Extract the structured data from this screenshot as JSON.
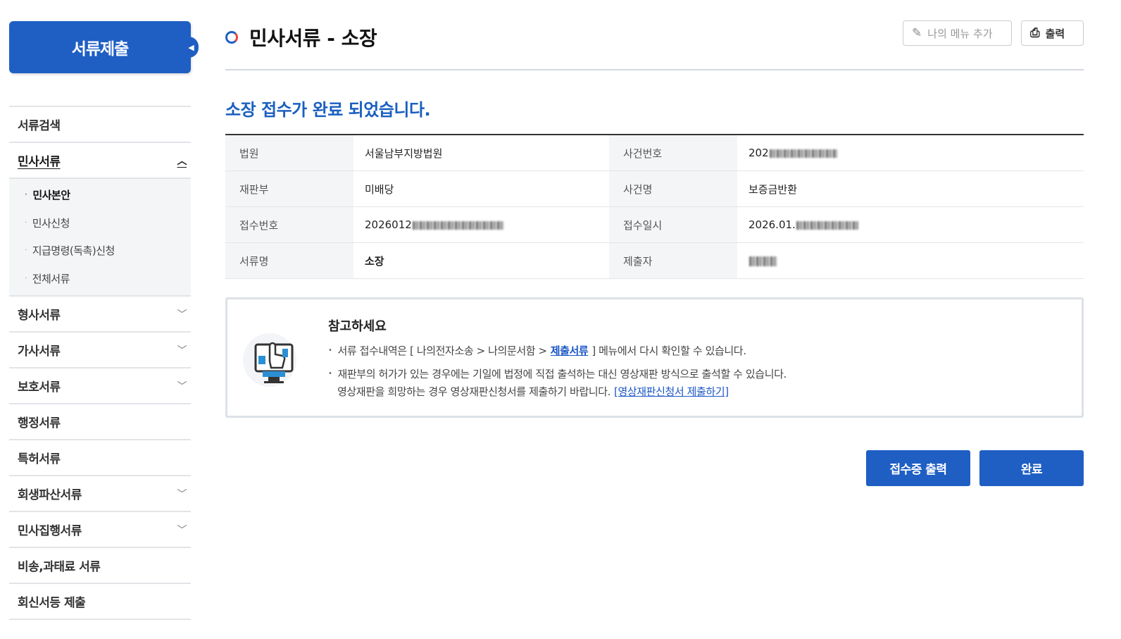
{
  "sidebar": {
    "title": "서류제출",
    "items": [
      {
        "label": "서류검색"
      },
      {
        "label": "민사서류",
        "sub": [
          "민사본안",
          "민사신청",
          "지급명령(독촉)신청",
          "전체서류"
        ]
      },
      {
        "label": "형사서류"
      },
      {
        "label": "가사서류"
      },
      {
        "label": "보호서류"
      },
      {
        "label": "행정서류"
      },
      {
        "label": "특허서류"
      },
      {
        "label": "회생파산서류"
      },
      {
        "label": "민사집행서류"
      },
      {
        "label": "비송,과태료 서류"
      },
      {
        "label": "회신서등 제출"
      }
    ]
  },
  "header": {
    "title": "민사서류 - 소장",
    "add_menu_label": "나의 메뉴 추가",
    "print_label": "출력"
  },
  "main": {
    "done_message": "소장 접수가 완료 되었습니다.",
    "info": {
      "court_label": "법원",
      "court_value": "서울남부지방법원",
      "case_no_label": "사건번호",
      "case_no_value": "202",
      "division_label": "재판부",
      "division_value": "미배당",
      "case_name_label": "사건명",
      "case_name_value": "보증금반환",
      "receipt_no_label": "접수번호",
      "receipt_no_value": "2026012",
      "receipt_date_label": "접수일시",
      "receipt_date_value": "2026.01.",
      "doc_name_label": "서류명",
      "doc_name_value": "소장",
      "submitter_label": "제출자"
    },
    "note": {
      "title": "참고하세요",
      "line1_pre": "서류 접수내역은 [ 나의전자소송 > 나의문서함 >",
      "line1_link": "제출서류",
      "line1_post": "] 메뉴에서 다시 확인할 수 있습니다.",
      "line2": "재판부의 허가가 있는 경우에는 기일에 법정에 직접 출석하는 대신 영상재판 방식으로 출석할 수 있습니다.",
      "line3_pre": "영상재판을 희망하는 경우 영상재판신청서를 제출하기 바랍니다.",
      "line3_link": "[영상재판신청서 제출하기]"
    },
    "buttons": {
      "receipt_print": "접수증 출력",
      "complete": "완료"
    }
  },
  "colors": {
    "primary": "#1f5fc4",
    "link": "#1a55c6",
    "accent_red": "#e8463a"
  }
}
